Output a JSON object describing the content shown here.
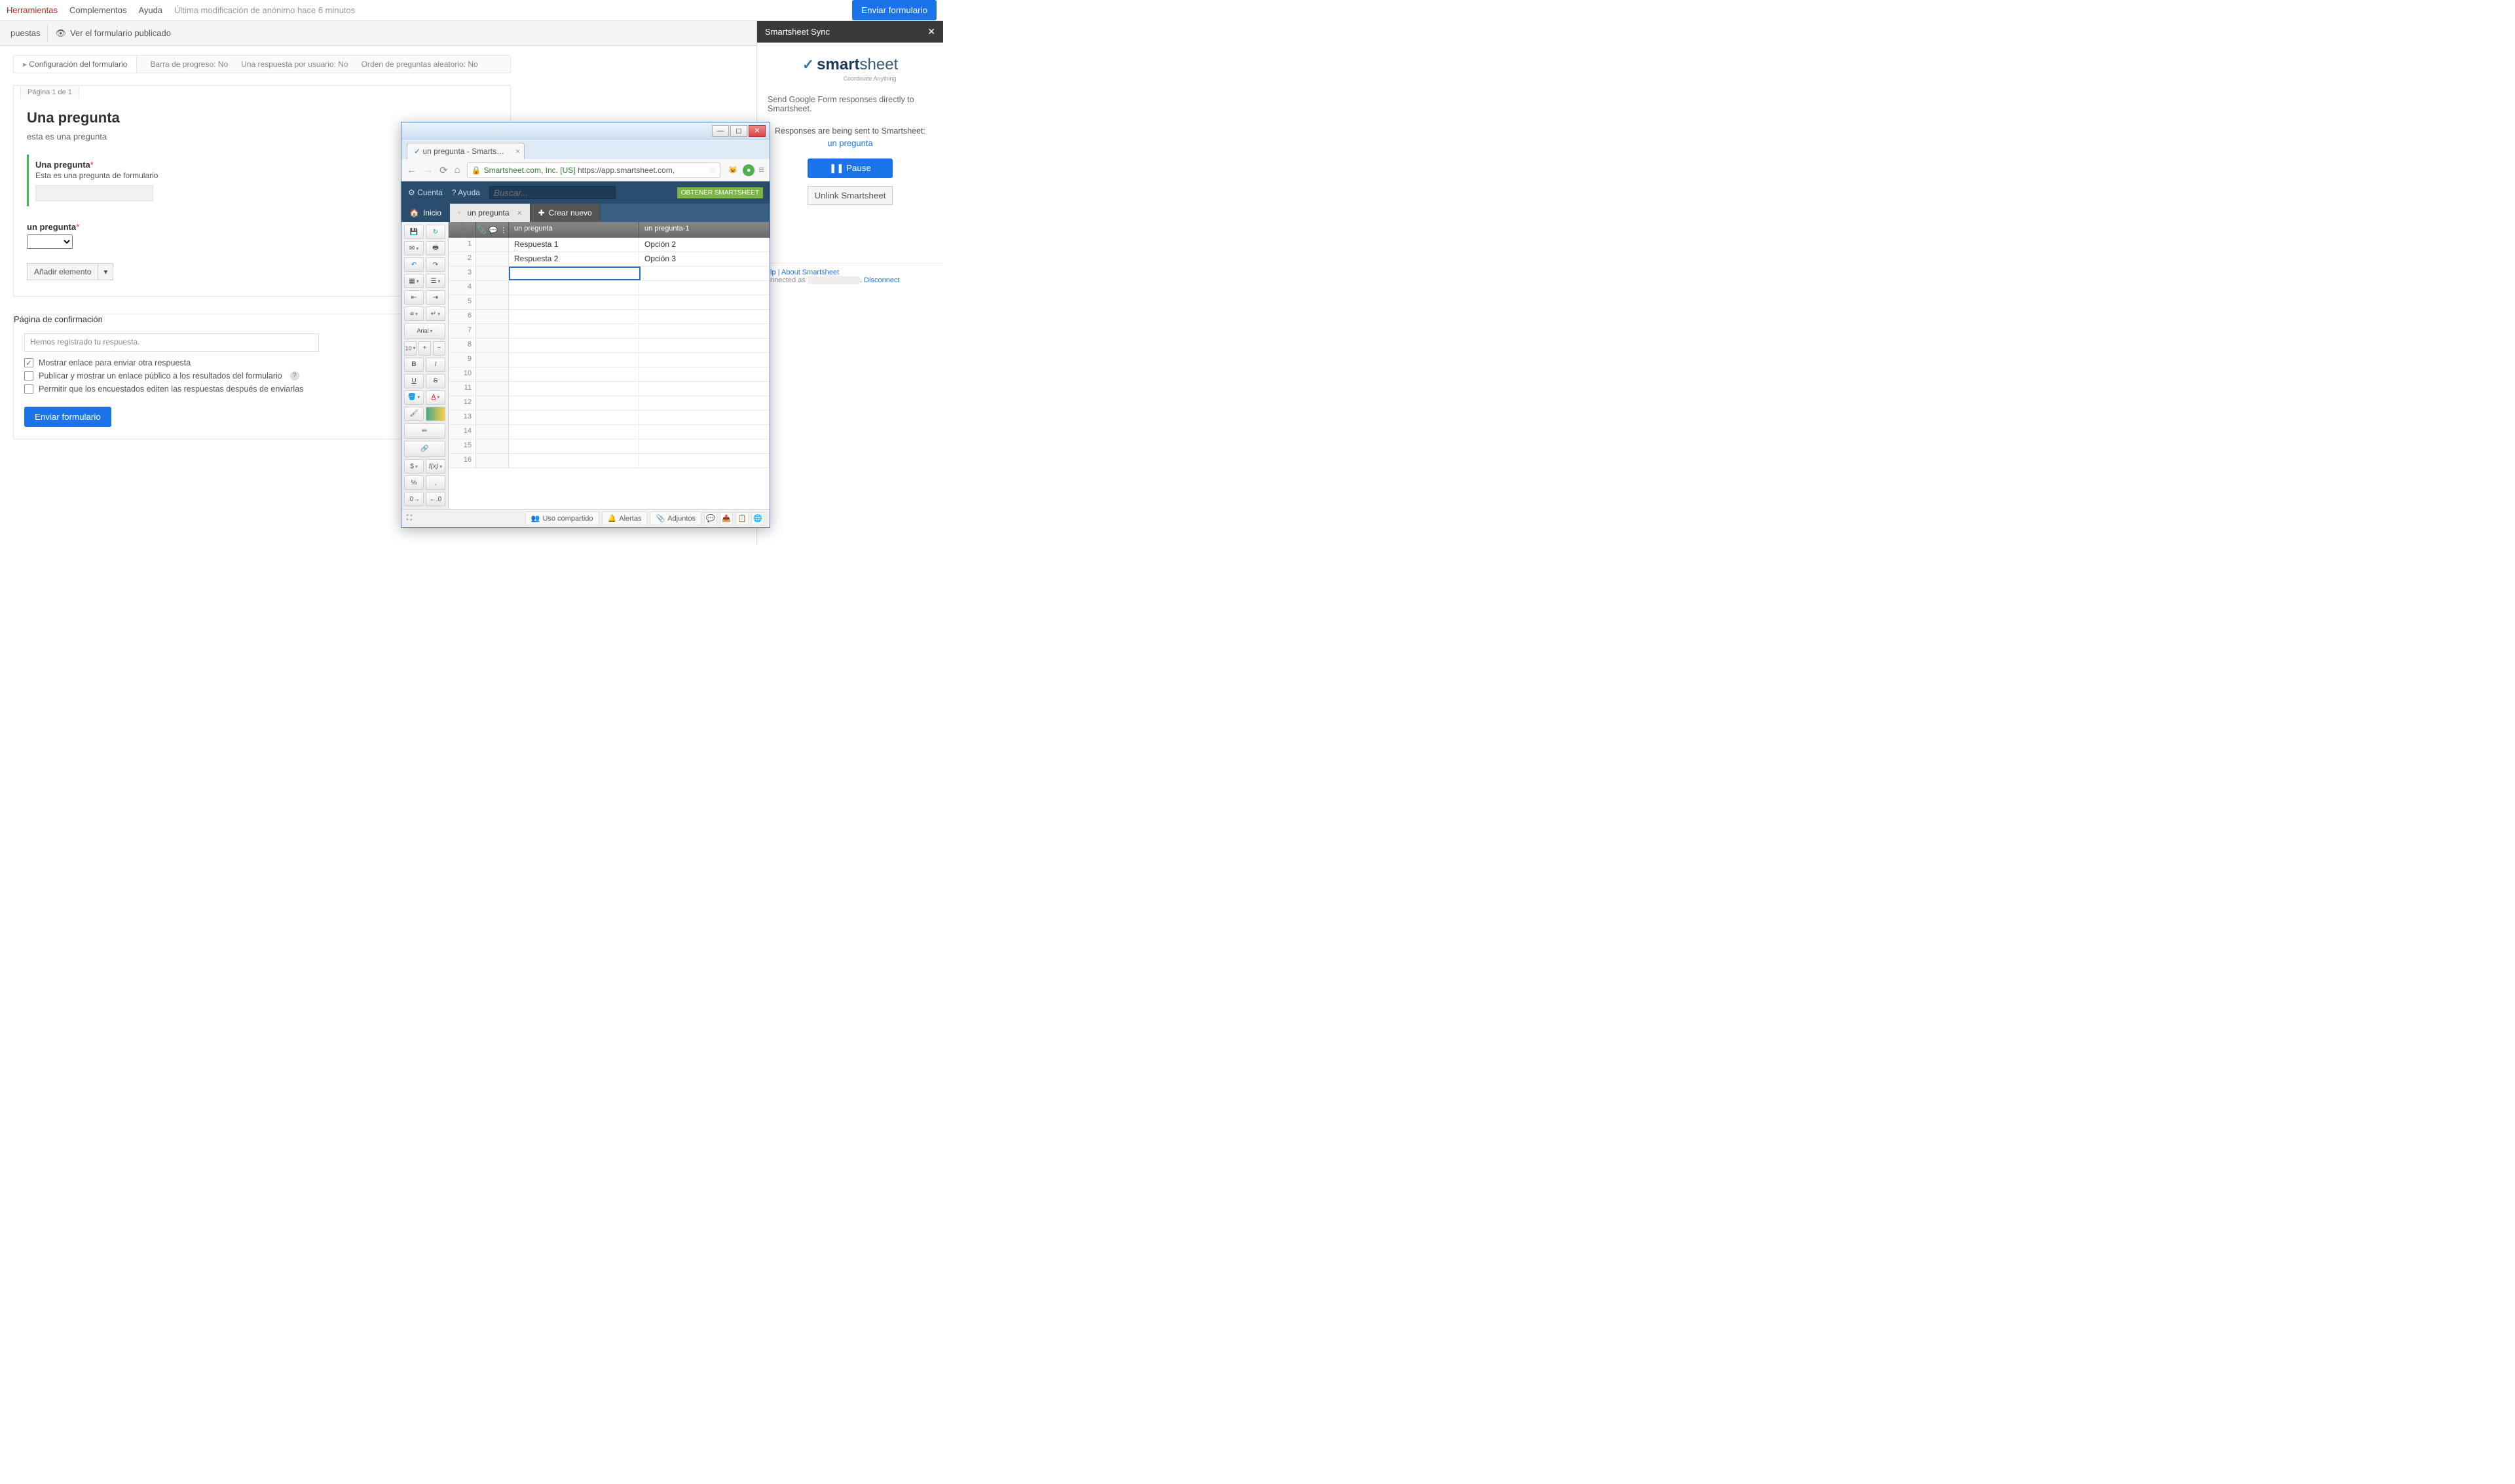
{
  "menu": {
    "herramientas": "Herramientas",
    "complementos": "Complementos",
    "ayuda": "Ayuda",
    "mod": "Última modificación de anónimo hace 6 minutos",
    "send": "Enviar formulario"
  },
  "toolbar": {
    "respuestas": "puestas",
    "ver": "Ver el formulario publicado"
  },
  "settings": {
    "tab": "Configuración del formulario",
    "barra": "Barra de progreso: No",
    "una": "Una respuesta por usuario: No",
    "orden": "Orden de preguntas aleatorio: No"
  },
  "form": {
    "page": "Página 1 de 1",
    "title": "Una pregunta",
    "desc": "esta es una pregunta",
    "q1_title": "Una pregunta",
    "q1_help": "Esta es una pregunta de formulario",
    "q2_title": "un pregunta",
    "add": "Añadir elemento"
  },
  "confirm": {
    "tab": "Página de confirmación",
    "msg": "Hemos registrado tu respuesta.",
    "opt1": "Mostrar enlace para enviar otra respuesta",
    "opt2": "Publicar y mostrar un enlace público a los resultados del formulario",
    "opt3": "Permitir que los encuestados editen las respuestas después de enviarlas",
    "send": "Enviar formulario"
  },
  "sidebar": {
    "title": "Smartsheet Sync",
    "tagline": "Coordinate Anything",
    "desc": "Send Google Form responses directly to Smartsheet.",
    "status1": "Responses are being sent to Smartsheet:",
    "link": "un pregunta",
    "pause": "❚❚  Pause",
    "unlink": "Unlink Smartsheet",
    "help": "Help",
    "about": "About Smartsheet",
    "connected": "Connected as",
    "disconnect": "Disconnect"
  },
  "browser": {
    "tab": "un pregunta - Smartshee...",
    "cert": "Smartsheet.com, Inc. [US]",
    "url": "https://app.smartsheet.com,",
    "cuenta": "Cuenta",
    "ayuda": "? Ayuda",
    "search": "Buscar...",
    "banner": "OBTENER SMARTSHEET",
    "inicio": "Inicio",
    "tab_active": "un pregunta",
    "crear": "Crear nuevo",
    "col1": "un pregunta",
    "col2": "un pregunta-1",
    "data": [
      [
        "Respuesta 1",
        "Opción 2"
      ],
      [
        "Respuesta 2",
        "Opción 3"
      ]
    ],
    "font": "Arial",
    "size": "10",
    "bottom": {
      "uso": "Uso compartido",
      "alertas": "Alertas",
      "adjuntos": "Adjuntos"
    }
  }
}
